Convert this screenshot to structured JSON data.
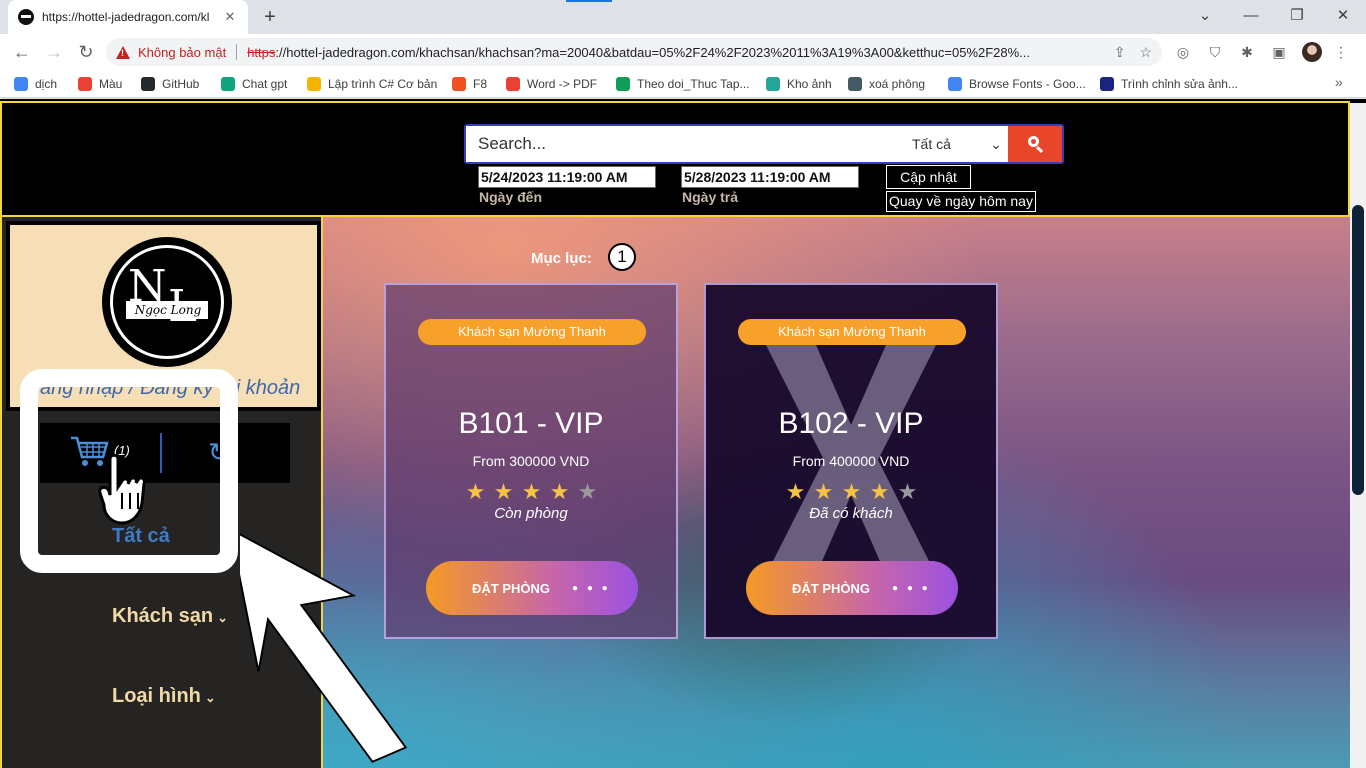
{
  "browser": {
    "tab_title": "https://hottel-jadedragon.com/kl",
    "tab_close": "✕",
    "new_tab": "+",
    "security_label": "Không bảo mật",
    "url_scheme": "https",
    "url_rest": "://hottel-jadedragon.com/khachsan/khachsan?ma=20040&batdau=05%2F24%2F2023%2011%3A19%3A00&ketthuc=05%2F28%...",
    "bookmarks": [
      {
        "label": "dịch",
        "color": "#4285f4"
      },
      {
        "label": "Màu",
        "color": "#e94235"
      },
      {
        "label": "GitHub",
        "color": "#24292e"
      },
      {
        "label": "Chat gpt",
        "color": "#10a37f"
      },
      {
        "label": "Lập trình C# Cơ bản",
        "color": "#f4b400"
      },
      {
        "label": "F8",
        "color": "#f05123"
      },
      {
        "label": "Word -> PDF",
        "color": "#e94235"
      },
      {
        "label": "Theo doi_Thuc Tap...",
        "color": "#0f9d58"
      },
      {
        "label": "Kho ảnh",
        "color": "#26a69a"
      },
      {
        "label": "xoá phông",
        "color": "#455a64"
      },
      {
        "label": "Browse Fonts - Goo...",
        "color": "#4285f4"
      },
      {
        "label": "Trình chỉnh sửa ảnh...",
        "color": "#1a237e"
      }
    ]
  },
  "header": {
    "search_placeholder": "Search...",
    "search_category": "Tất cả",
    "checkin_value": "5/24/2023 11:19:00 AM",
    "checkin_label": "Ngày đến",
    "checkout_value": "5/28/2023 11:19:00 AM",
    "checkout_label": "Ngày trả",
    "update_label": "Cập nhật",
    "today_label": "Quay về ngày hôm nay"
  },
  "sidebar": {
    "logo_initials_n": "N",
    "logo_initials_l": "L",
    "logo_script": "Ngọc Long",
    "login_text": "ăng nhập / Đăng ký tài khoản",
    "cart_count": "(1)",
    "nav_all": "Tất cả",
    "nav_hotel": "Khách sạn",
    "nav_type": "Loại hình"
  },
  "main": {
    "index_label": "Mục lục:",
    "index_page": "1",
    "cards": [
      {
        "badge": "Khách sạn Mường Thanh",
        "name": "B101 - VIP",
        "price": "From 300000 VND",
        "rating": 4,
        "max_rating": 5,
        "status": "Còn phòng",
        "button": "ĐẶT PHÒNG",
        "unavailable": false
      },
      {
        "badge": "Khách sạn Mường Thanh",
        "name": "B102 - VIP",
        "price": "From 400000 VND",
        "rating": 4,
        "max_rating": 5,
        "status": "Đã có khách",
        "button": "ĐẶT PHÒNG",
        "unavailable": true
      }
    ]
  },
  "colors": {
    "accent_yellow": "#f4d63a",
    "search_button": "#e8462a",
    "badge_orange": "#f7a12a",
    "star_filled": "#f5c242",
    "star_empty": "#9a9a9a"
  }
}
